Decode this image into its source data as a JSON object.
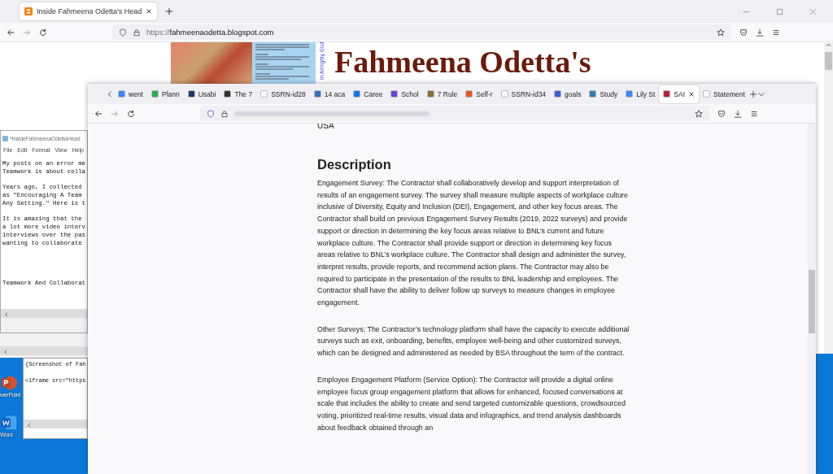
{
  "back_window": {
    "tab": {
      "title": "Inside Fahmeena Odetta's Head",
      "selected": true
    },
    "url_prefix": "https://",
    "url_host": "fahmeenaodetta.blogspot.com",
    "blog_header": {
      "side_text": "In Almighty God",
      "title": "Fahmeena Odetta's"
    }
  },
  "notepad": {
    "title": "*InsideFahmeenaOdettaHead",
    "menu": [
      "File",
      "Edit",
      "Format",
      "View",
      "Help"
    ],
    "blocks": [
      [
        "My posts on an error me",
        "Teamwork is about colla"
      ],
      [
        "Years ago, I collected",
        "as \"Encouraging A Team",
        "Any Setting.\" Here is t"
      ],
      [
        "It is amazing that the",
        "a lot more video interv",
        "interviews over the pas",
        "wanting to collaborate"
      ],
      [
        "Teamwork And Collaborat"
      ]
    ]
  },
  "notepad_2": {
    "lines": [
      "{Screenshot of Fah",
      "<iframe src=\"https"
    ]
  },
  "desktop_icons": [
    {
      "label": "werPoint",
      "kind": "powerpoint"
    },
    {
      "label": "Word",
      "kind": "word"
    }
  ],
  "front_window": {
    "tabs": [
      {
        "label": "went",
        "color": "#4285f4",
        "selected": false
      },
      {
        "label": "Plann",
        "color": "#34a853",
        "selected": false
      },
      {
        "label": "Usabi",
        "color": "#1b3a6b",
        "selected": false
      },
      {
        "label": "The 7",
        "color": "#333333",
        "selected": false
      },
      {
        "label": "SSRN-id28",
        "color": "#f9f9fb",
        "selected": false
      },
      {
        "label": "14 aca",
        "color": "#3b6fb6",
        "selected": false
      },
      {
        "label": "Caree",
        "color": "#1a73e8",
        "selected": false
      },
      {
        "label": "Schol",
        "color": "#6a3fd8",
        "selected": false
      },
      {
        "label": "7 Rule",
        "color": "#8a6d3b",
        "selected": false
      },
      {
        "label": "Self-r",
        "color": "#e8562a",
        "selected": false
      },
      {
        "label": "SSRN-id34",
        "color": "#f9f9fb",
        "selected": false
      },
      {
        "label": "goals",
        "color": "#3a5fcd",
        "selected": false
      },
      {
        "label": "Study",
        "color": "#2b7bb9",
        "selected": false
      },
      {
        "label": "Lily St",
        "color": "#4285f4",
        "selected": false
      },
      {
        "label": "SAI",
        "color": "#b22234",
        "selected": true
      },
      {
        "label": "Statement",
        "color": "#f9f9fb",
        "selected": false
      }
    ],
    "content": {
      "address_line": "USA",
      "heading": "Description",
      "paragraphs": [
        "Engagement Survey:  The Contractor shall collaboratively develop and support interpretation of results of an engagement survey. The survey shall measure multiple aspects of workplace culture inclusive of Diversity, Equity and Inclusion (DEI), Engagement, and other key focus areas. The Contractor shall build on previous Engagement Survey Results (2019, 2022 surveys) and provide support or direction in determining the key focus areas relative to BNL’s current and future workplace culture. The Contractor shall provide support or direction in determining key focus areas relative to BNL’s workplace culture.  The Contractor shall design and administer the survey, interpret results, provide reports, and recommend action plans. The Contractor may also be required to participate in the presentation of the results to BNL leadership and employees.  The Contractor shall have the ability to deliver follow up surveys to measure changes in employee engagement.",
        "Other Surveys: The Contractor’s technology platform shall have the capacity to execute additional surveys such as exit, onboarding, benefits, employee well-being and other customized surveys, which can be designed and administered as needed by BSA throughout the term of the contract.",
        "Employee Engagement Platform (Service Option):  The Contractor will provide a digital online employee focus group engagement platform that allows for enhanced, focused conversations at scale that includes the ability to create and send targeted customizable questions, crowdsourced voting, prioritized real-time results, visual data and infographics, and trend analysis dashboards about feedback obtained through an"
      ]
    }
  }
}
